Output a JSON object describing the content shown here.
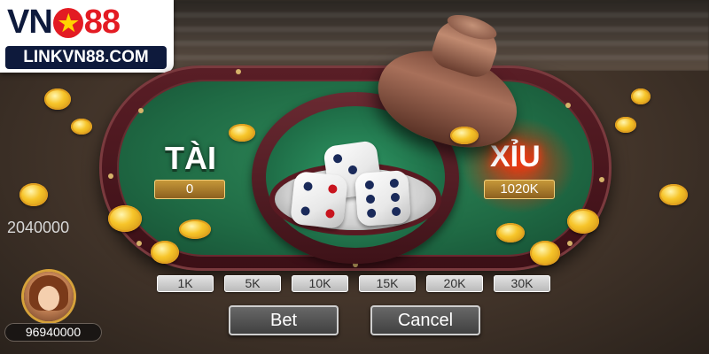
{
  "logo": {
    "brand_left": "VN",
    "brand_right": "88",
    "link": "LINKVN88.COM"
  },
  "table": {
    "tai": {
      "label": "TÀI",
      "amount": "0"
    },
    "xiu": {
      "label": "XỈU",
      "amount": "1020K"
    }
  },
  "side_amount": "2040000",
  "chips": [
    "1K",
    "5K",
    "10K",
    "15K",
    "20K",
    "30K"
  ],
  "player": {
    "balance": "96940000"
  },
  "actions": {
    "bet": "Bet",
    "cancel": "Cancel"
  },
  "dice": [
    3,
    4,
    6
  ],
  "colors": {
    "felt": "#1f6a44",
    "rim": "#5a1e26",
    "gold": "#f7c52a",
    "xiu_glow": "#ff3a1a"
  },
  "icons": {
    "logo_star": "star-icon",
    "coin": "gold-coin-icon",
    "cup": "dice-shaker-cup-icon"
  }
}
